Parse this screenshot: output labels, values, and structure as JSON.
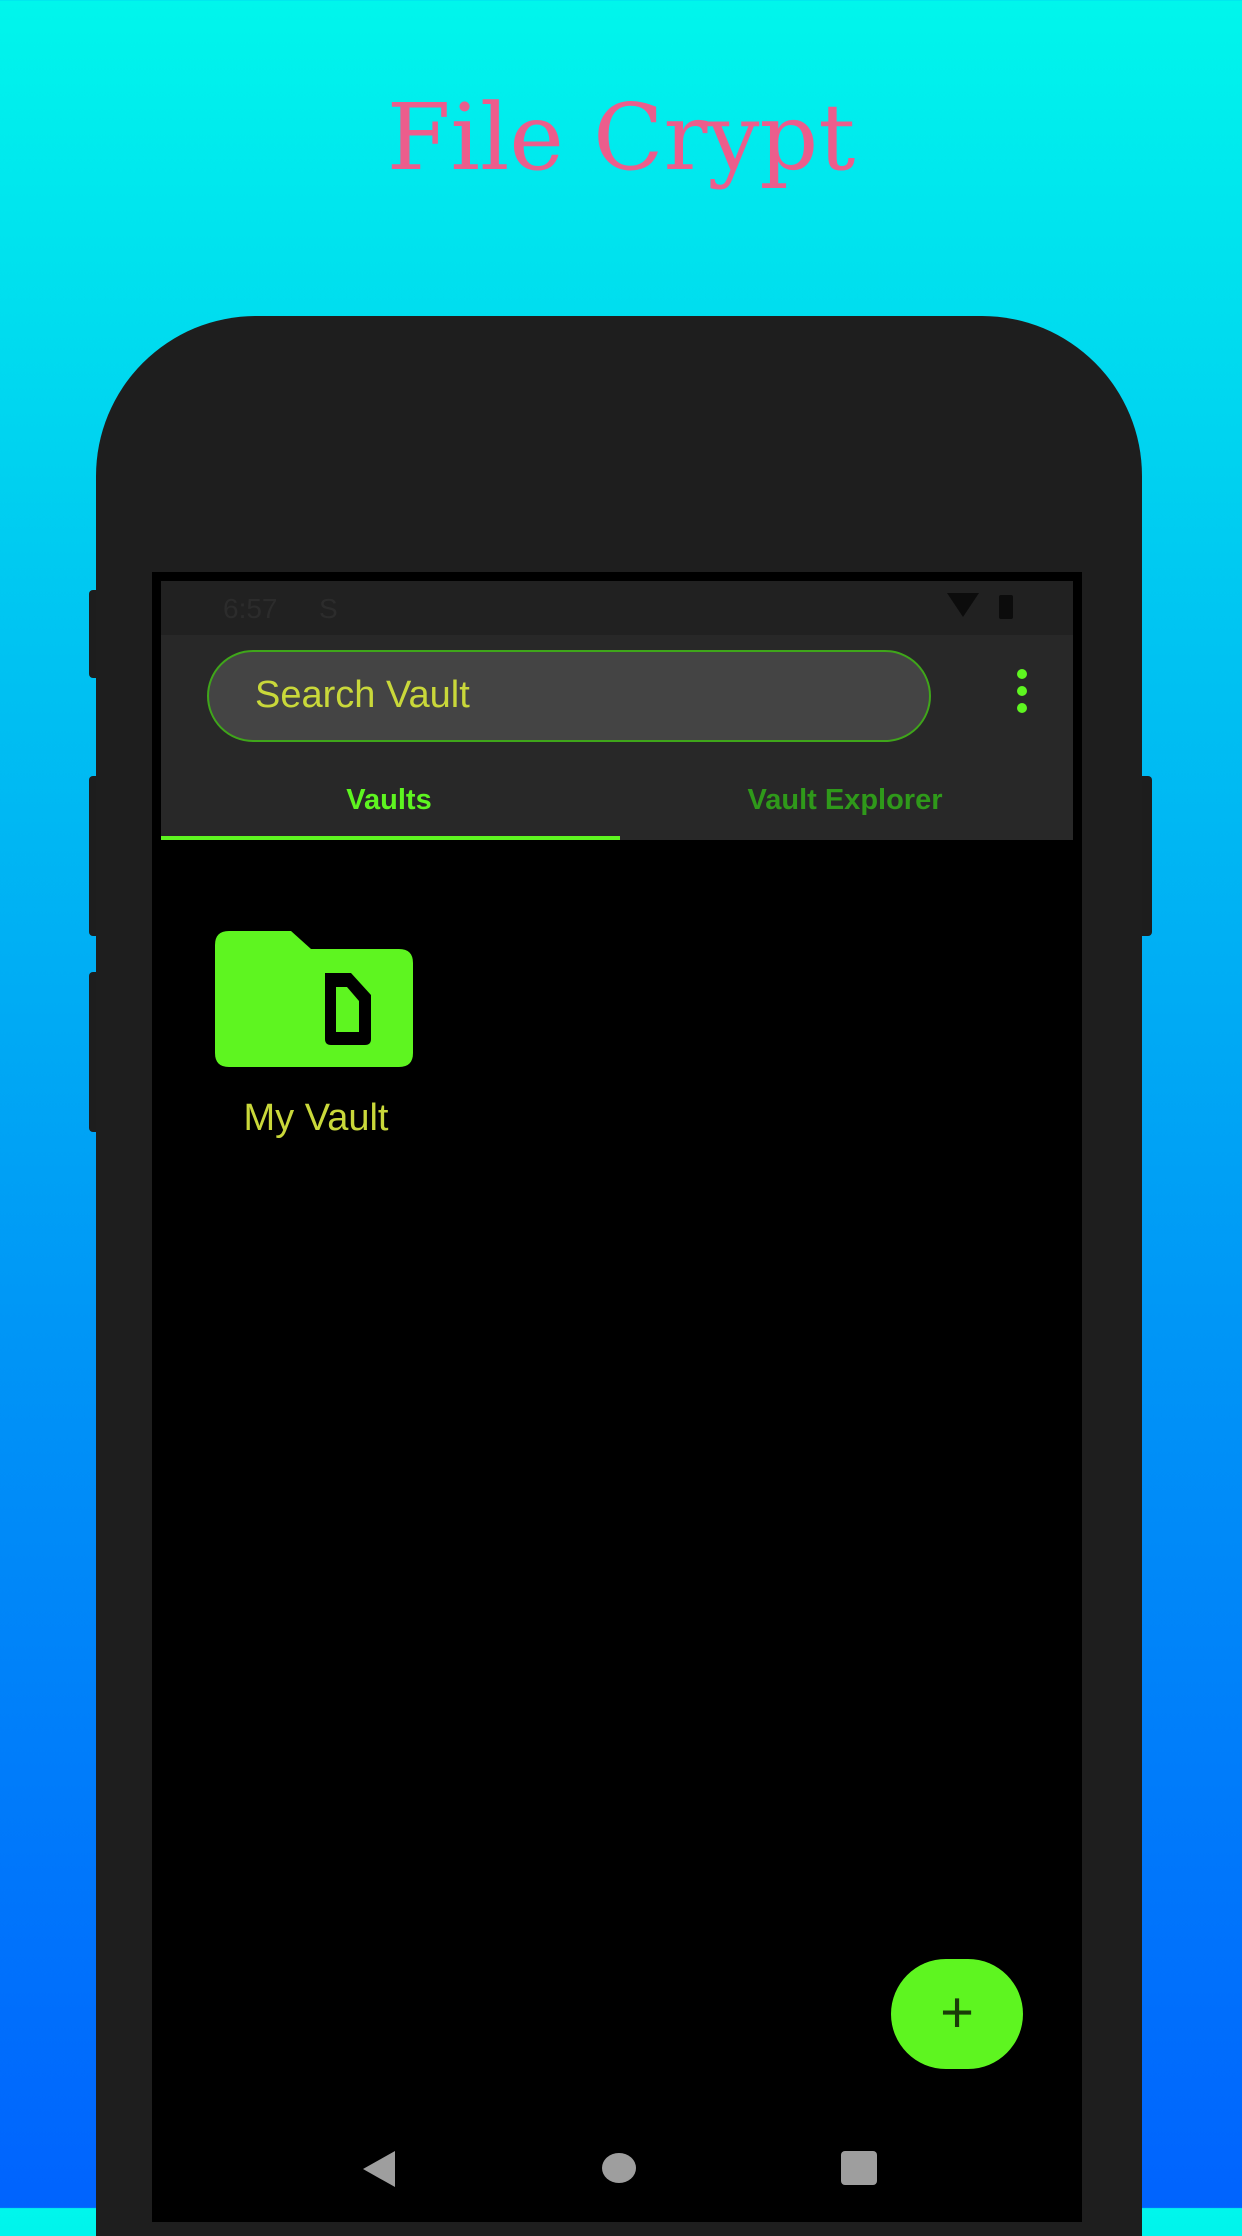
{
  "promo": {
    "title": "File Crypt"
  },
  "status_bar": {
    "time": "6:57",
    "notification_icon": "s-icon",
    "icons": [
      "wifi-icon",
      "battery-icon"
    ]
  },
  "search": {
    "placeholder": "Search Vault"
  },
  "menu": {
    "icon": "overflow-menu-icon"
  },
  "tabs": [
    {
      "label": "Vaults",
      "active": true
    },
    {
      "label": "Vault Explorer",
      "active": false
    }
  ],
  "vaults": [
    {
      "name": "My Vault",
      "icon": "folder-file-icon"
    }
  ],
  "fab": {
    "label": "+",
    "icon": "plus-icon"
  },
  "nav": {
    "icons": [
      "back-icon",
      "home-icon",
      "recents-icon"
    ]
  },
  "colors": {
    "accent_green": "#5ef520",
    "inactive_tab_green": "#2f991a",
    "label_yellow": "#c9d83a",
    "title_pink": "#ec5d8c",
    "app_bar": "#282828",
    "background_top": "#00f6ec",
    "background_bottom": "#0063fe"
  }
}
